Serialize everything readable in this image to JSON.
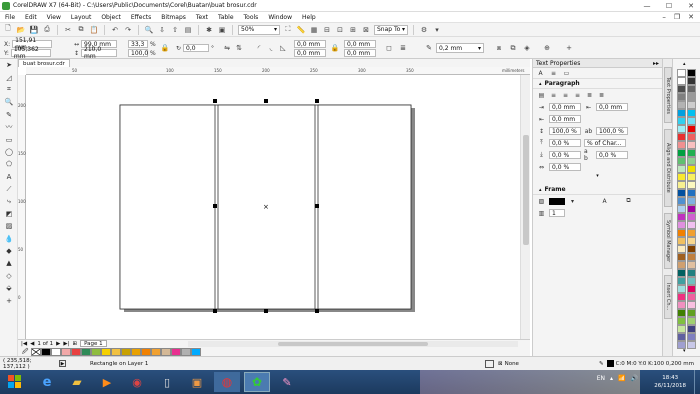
{
  "window": {
    "title": "CorelDRAW X7 (64-Bit) - C:\\Users\\Public\\Documents\\Corel\\Buatan\\buat brosur.cdr",
    "minimize": "—",
    "maximize": "☐",
    "close": "✕"
  },
  "menu": {
    "items": [
      "File",
      "Edit",
      "View",
      "Layout",
      "Object",
      "Effects",
      "Bitmaps",
      "Text",
      "Table",
      "Tools",
      "Window",
      "Help"
    ]
  },
  "toolbar": {
    "zoom": "50%",
    "snap": "Snap To"
  },
  "property_bar": {
    "x_label": "X:",
    "x": "151,91 mm",
    "y_label": "Y:",
    "y": "105,362 mm",
    "w": "99,0 mm",
    "h": "210,0 mm",
    "sx": "33,3",
    "sy": "100,0",
    "pct": "%",
    "angle": "0,0",
    "deg": "°",
    "pos1": "0,0 mm",
    "pos2": "0,0 mm",
    "pos3": "0,0 mm",
    "pos4": "0,0 mm",
    "outline": "0,2 mm"
  },
  "document": {
    "tab": "buat brosur.cdr"
  },
  "ruler": {
    "h_ticks": [
      "50",
      "100",
      "150",
      "200",
      "250",
      "300",
      "350",
      "millimeters"
    ],
    "v_ticks": [
      "200",
      "150",
      "100",
      "50",
      "0"
    ]
  },
  "page_nav": {
    "counter": "1 of 1",
    "page_tab": "Page 1"
  },
  "panel": {
    "title": "Text Properties",
    "paragraph": "Paragraph",
    "frame": "Frame",
    "indent_left": "0,0 mm",
    "indent_right": "0,0 mm",
    "first_line": "0,0 mm",
    "line_spacing": "100,0 %",
    "char_spacing": "0,0 %",
    "units": "% of Char...",
    "before_para": "0,0 %",
    "word_spacing": "100,0 %",
    "lang_spacing": "0,0 %",
    "after_para": "0,0 %",
    "frame_columns": "1"
  },
  "side_tabs": [
    "Text Properties",
    "Align and Distribute",
    "Symbol Manager",
    "Insert Ch..."
  ],
  "status": {
    "coords": "( 235,518; 137,112 )",
    "layer": "Rectangle on Layer 1",
    "fill_none": "None",
    "outline_info": "C:0 M:0 Y:0 K:100  0,200 mm"
  },
  "clock": {
    "time": "18:43",
    "date": "26/11/2018"
  },
  "colors": {
    "bottom_swatches": [
      "#000000",
      "#ffffff",
      "#f2a8a8",
      "#e84040",
      "#2e8b57",
      "#8fbc3f",
      "#f5d000",
      "#f0c040",
      "#c8a000",
      "#e8a000",
      "#f08000",
      "#f0a030",
      "#d4b896",
      "#e83090",
      "#b0b0b0",
      "#00aaff"
    ],
    "right_palette": [
      "#ffffff",
      "#000000",
      "#ffffff",
      "#333333",
      "#4d4d4d",
      "#666666",
      "#808080",
      "#999999",
      "#b3b3b3",
      "#cccccc",
      "#00a0e0",
      "#00c0f0",
      "#30d0f0",
      "#70e0f8",
      "#a0f0f8",
      "#e80000",
      "#e83030",
      "#f06060",
      "#f09090",
      "#f8c0c0",
      "#00a040",
      "#20b050",
      "#60c070",
      "#90d090",
      "#c0e8c0",
      "#f0e000",
      "#f8e830",
      "#f8f060",
      "#f8f090",
      "#fcf8c0",
      "#0050a0",
      "#2070c0",
      "#5090d0",
      "#80b0e0",
      "#b0d0f0",
      "#a000a0",
      "#c030c0",
      "#d060d0",
      "#e090e0",
      "#f0c0f0",
      "#f08000",
      "#f0a030",
      "#f0c060",
      "#f8d890",
      "#fcecc0",
      "#804000",
      "#a06020",
      "#c08040",
      "#d0a070",
      "#e0c0a0",
      "#006060",
      "#208080",
      "#40a0a0",
      "#70c0c0",
      "#a0e0e0",
      "#e00060",
      "#f03080",
      "#f060a0",
      "#f090c0",
      "#f8c0e0",
      "#408000",
      "#60a020",
      "#80c040",
      "#a0d070",
      "#c8e8a0",
      "#404080",
      "#6060a0",
      "#8080c0",
      "#a0a0d0",
      "#c8c8e8"
    ]
  }
}
